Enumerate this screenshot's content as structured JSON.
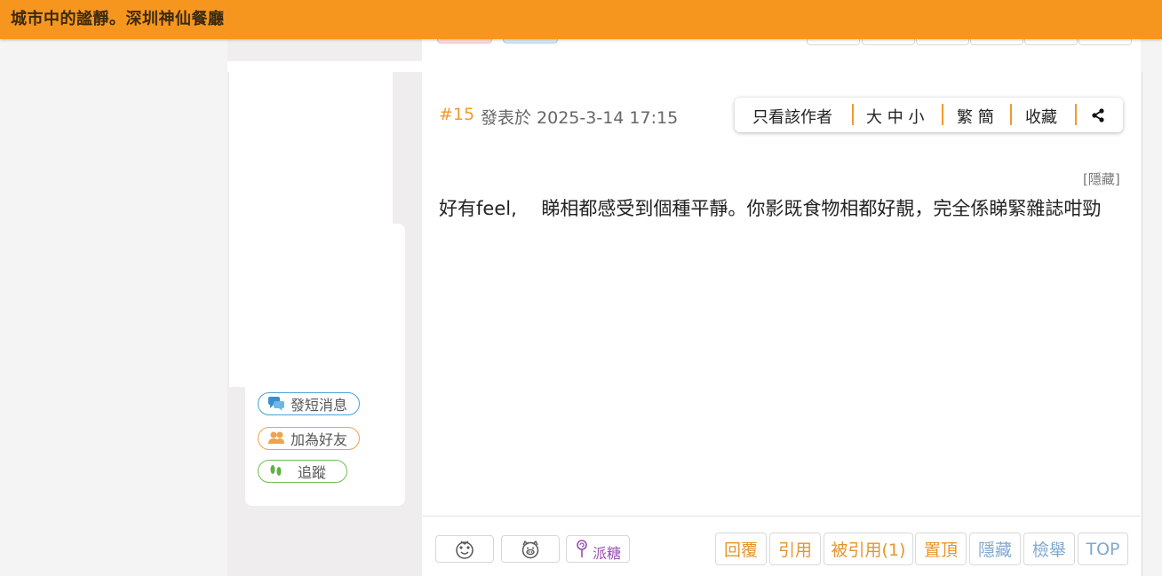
{
  "topbar": {
    "title": "城市中的謐靜。深圳神仙餐廳"
  },
  "profile": {
    "actions": {
      "message": "發短消息",
      "add_friend": "加為好友",
      "follow": "追蹤"
    }
  },
  "post": {
    "number": "#15",
    "posted_at": "發表於 2025-3-14 17:15",
    "tools": {
      "author_only": "只看該作者",
      "font_size": "大 中 小",
      "script": "繁 簡",
      "favorite": "收藏",
      "share_icon": "share-icon"
    },
    "hide_link": "[隱藏]",
    "body": "好有feel,　 睇相都感受到個種平靜。你影既食物相都好靚，完全係睇緊雜誌咁勁"
  },
  "footer": {
    "candy_label": "派糖",
    "buttons": {
      "reply": "回覆",
      "quote": "引用",
      "quoted_by": "被引用(1)",
      "pin": "置頂",
      "hide": "隱藏",
      "report": "檢舉",
      "top": "TOP"
    }
  },
  "colors": {
    "topbar": "#f7961f",
    "accent_orange": "#e7952b",
    "accent_blue": "#7fa9d1",
    "message_blue": "#4aa3d8",
    "follow_green": "#6cbf4c"
  }
}
